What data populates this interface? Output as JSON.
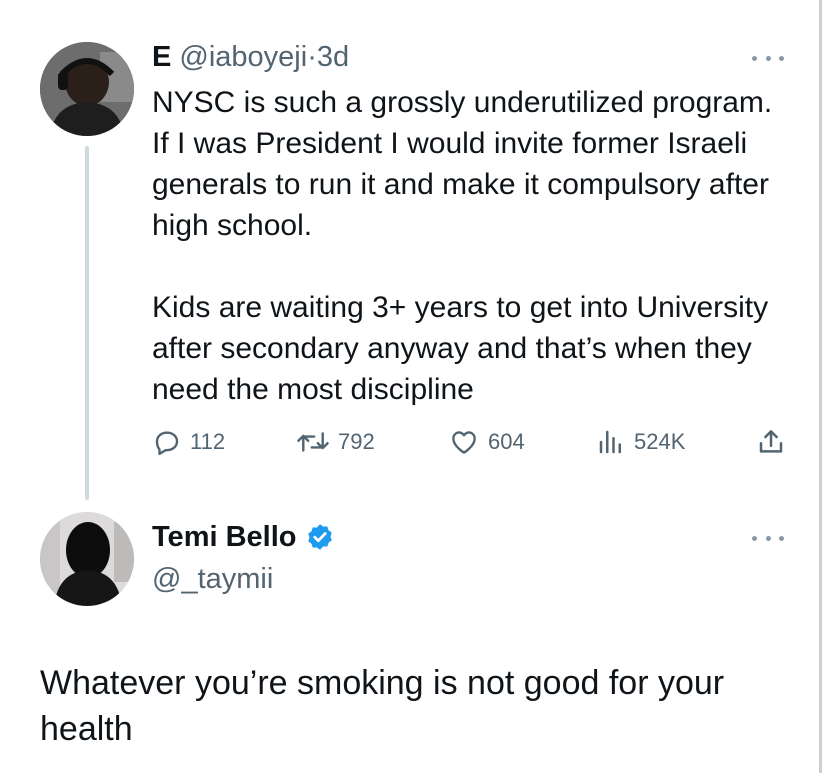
{
  "parent_tweet": {
    "display_name": "E",
    "handle": "@iaboyeji",
    "separator": "·",
    "time": "3d",
    "paragraphs": [
      "NYSC is such a grossly underutilized program. If I was President I would invite former Israeli generals to run it and make it compulsory after high school.",
      "Kids are waiting 3+ years to get into University after secondary anyway and that’s when they need the most discipline"
    ],
    "actions": {
      "replies": "112",
      "reposts": "792",
      "likes": "604",
      "views": "524K"
    }
  },
  "reply_tweet": {
    "display_name": "Temi Bello",
    "handle": "@_taymii",
    "verified": true,
    "text": "Whatever you’re smoking is not good for your health"
  },
  "icons": [
    "more-icon",
    "reply-icon",
    "repost-icon",
    "like-icon",
    "views-icon",
    "share-icon",
    "verified-badge-icon"
  ],
  "colors": {
    "text": "#0f1419",
    "muted": "#536471",
    "verified": "#1d9bf0",
    "thread_line": "#cfd9de"
  }
}
